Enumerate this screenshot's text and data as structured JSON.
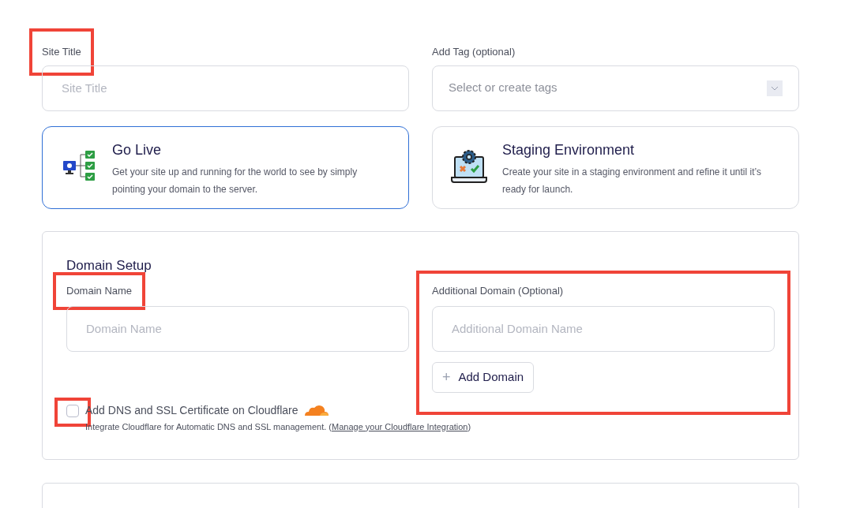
{
  "site_title": {
    "label": "Site Title",
    "placeholder": "Site Title",
    "highlighted": true
  },
  "tag": {
    "label": "Add Tag (optional)",
    "placeholder": "Select or create tags"
  },
  "deploy_options": [
    {
      "kind": "live",
      "title": "Go Live",
      "description": "Get your site up and running for the world to see by simply pointing your domain to the server.",
      "selected": true
    },
    {
      "kind": "staging",
      "title": "Staging Environment",
      "description": "Create your site in a staging environment and refine it until it’s ready for launch.",
      "selected": false
    }
  ],
  "domain_setup": {
    "title": "Domain Setup",
    "domain_name": {
      "label": "Domain Name",
      "placeholder": "Domain Name",
      "highlighted": true
    },
    "additional_domain": {
      "label": "Additional Domain (Optional)",
      "placeholder": "Additional Domain Name",
      "button": "+",
      "button_label": "Add Domain",
      "highlighted": true
    },
    "cloudflare": {
      "label": "Add DNS and SSL Certificate on Cloudflare",
      "checked": false,
      "highlighted": true,
      "note": "Integrate Cloudflare for Automatic DNS and SSL management. (",
      "link": "Manage your Cloudflare Integration",
      "note_end": ")"
    }
  }
}
